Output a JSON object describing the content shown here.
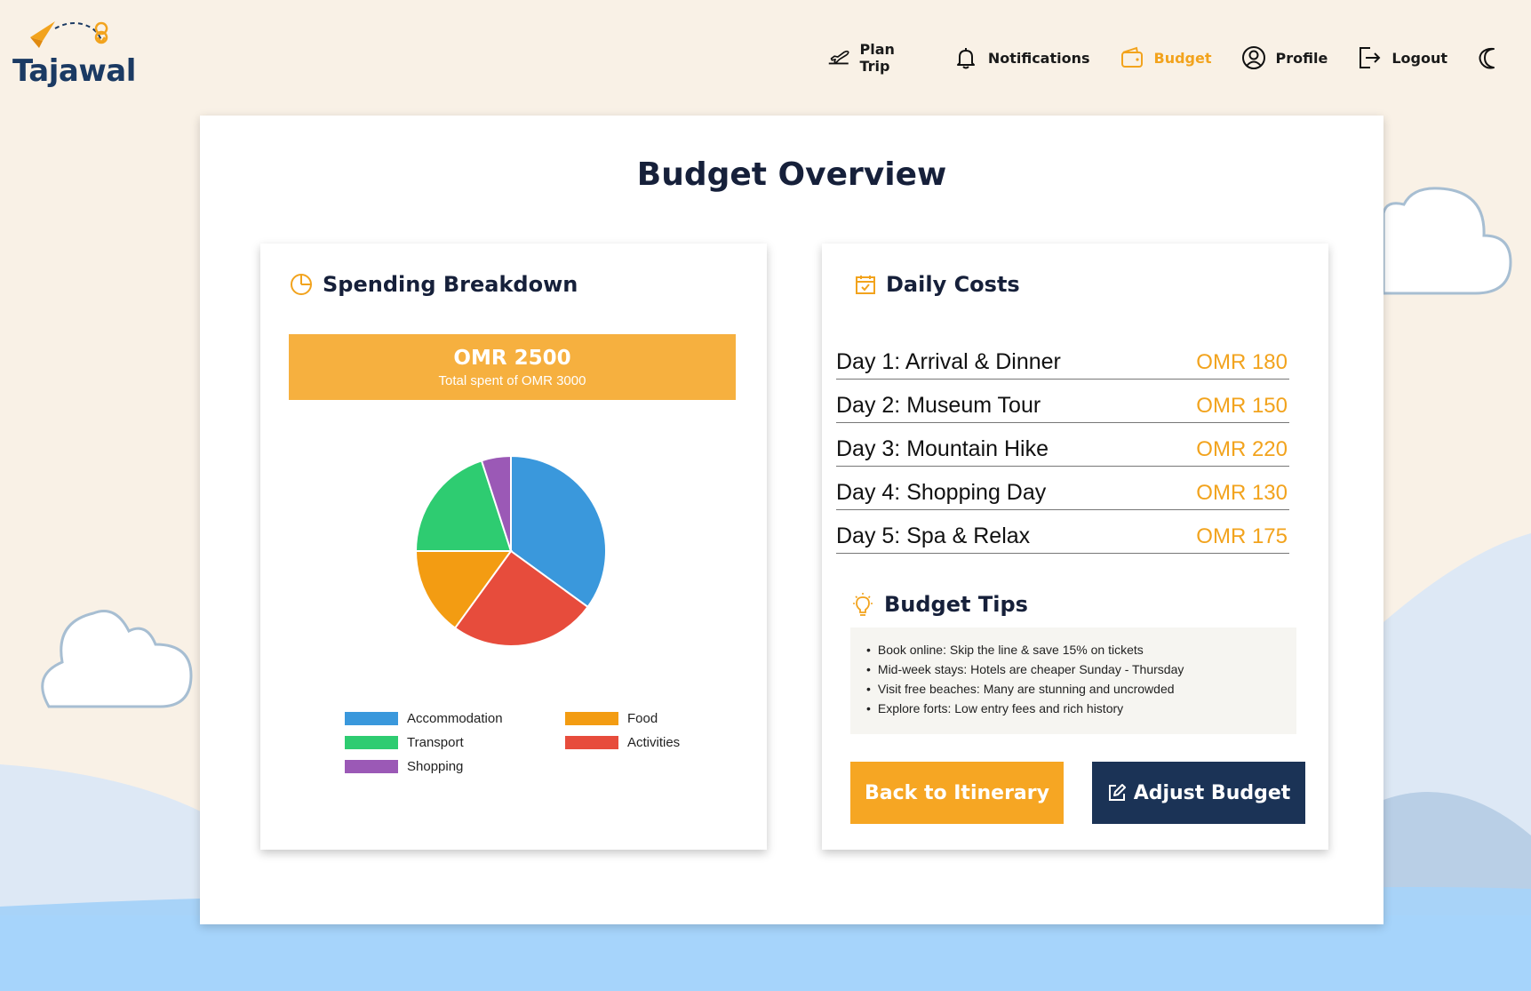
{
  "app": {
    "brand": "Tajawal"
  },
  "nav": {
    "items": [
      {
        "label": "Plan Trip",
        "icon": "plane-icon",
        "active": false
      },
      {
        "label": "Notifications",
        "icon": "bell-icon",
        "active": false
      },
      {
        "label": "Budget",
        "icon": "wallet-icon",
        "active": true
      },
      {
        "label": "Profile",
        "icon": "user-circle-icon",
        "active": false
      },
      {
        "label": "Logout",
        "icon": "logout-icon",
        "active": false
      }
    ],
    "theme_toggle_icon": "moon-icon"
  },
  "page": {
    "title": "Budget Overview"
  },
  "spending": {
    "title": "Spending Breakdown",
    "icon": "pie-clock-icon",
    "total_amount": "OMR 2500",
    "total_caption": "Total spent of OMR 3000"
  },
  "chart_data": {
    "type": "pie",
    "categories": [
      "Accommodation",
      "Activities",
      "Food",
      "Transport",
      "Shopping"
    ],
    "values": [
      35,
      25,
      15,
      20,
      5
    ],
    "colors": [
      "#3a98dc",
      "#e74c3c",
      "#f39c12",
      "#2ecc71",
      "#9b59b6"
    ],
    "legend": [
      {
        "label": "Accommodation",
        "color": "#3a98dc"
      },
      {
        "label": "Food",
        "color": "#f39c12"
      },
      {
        "label": "Transport",
        "color": "#2ecc71"
      },
      {
        "label": "Activities",
        "color": "#e74c3c"
      },
      {
        "label": "Shopping",
        "color": "#9b59b6"
      }
    ]
  },
  "daily": {
    "title": "Daily Costs",
    "icon": "calendar-check-icon",
    "rows": [
      {
        "name": "Day 1: Arrival & Dinner",
        "value": "OMR 180"
      },
      {
        "name": "Day 2: Museum Tour",
        "value": "OMR 150"
      },
      {
        "name": "Day 3: Mountain Hike",
        "value": "OMR 220"
      },
      {
        "name": "Day 4: Shopping Day",
        "value": "OMR 130"
      },
      {
        "name": "Day 5: Spa & Relax",
        "value": "OMR 175"
      }
    ]
  },
  "tips": {
    "title": "Budget Tips",
    "icon": "lightbulb-icon",
    "items": [
      "Book online: Skip the line & save 15% on tickets",
      "Mid-week stays: Hotels are cheaper Sunday - Thursday",
      "Visit free beaches: Many are stunning and uncrowded",
      "Explore forts: Low entry fees and rich history"
    ]
  },
  "actions": {
    "back_label": "Back to Itinerary",
    "adjust_label": "Adjust Budget"
  }
}
